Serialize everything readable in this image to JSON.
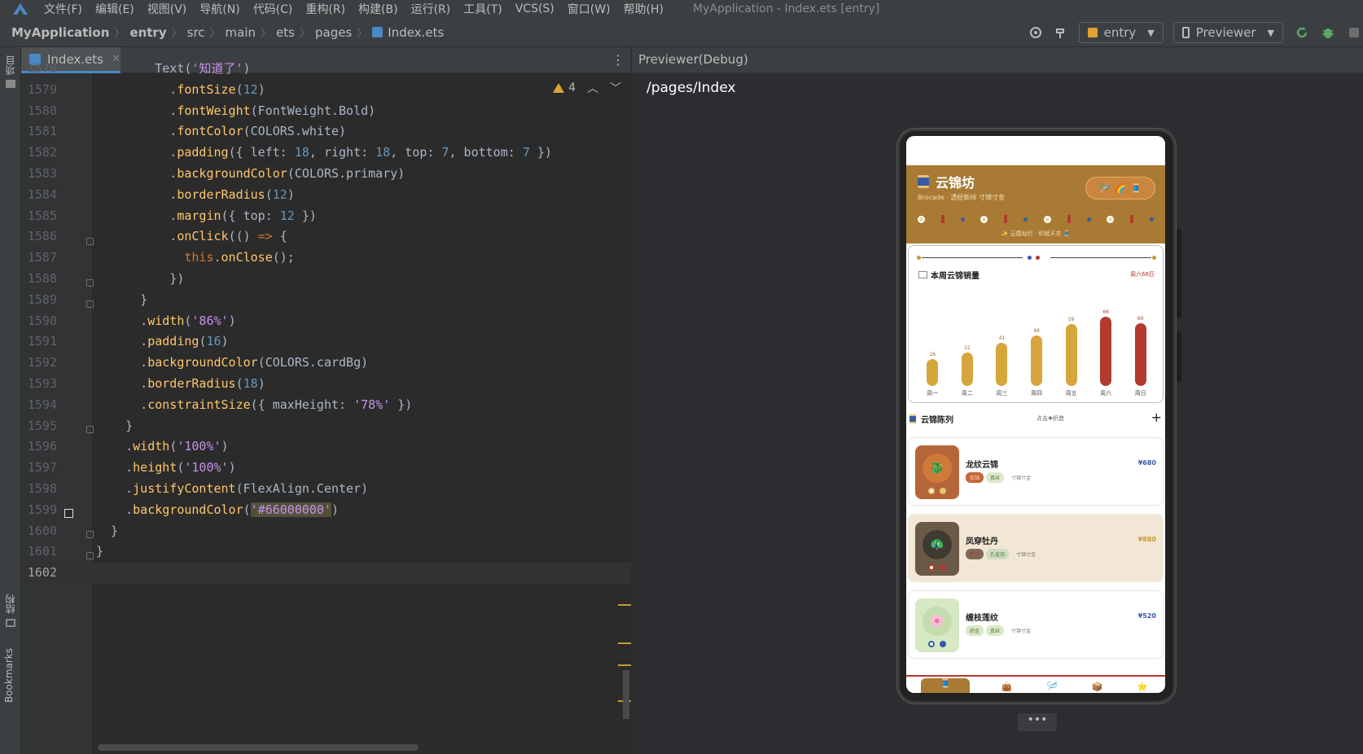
{
  "menu": {
    "items": [
      "文件(F)",
      "编辑(E)",
      "视图(V)",
      "导航(N)",
      "代码(C)",
      "重构(R)",
      "构建(B)",
      "运行(R)",
      "工具(T)",
      "VCS(S)",
      "窗口(W)",
      "帮助(H)"
    ],
    "window_title": "MyApplication - Index.ets [entry]"
  },
  "breadcrumb": [
    "MyApplication",
    "entry",
    "src",
    "main",
    "ets",
    "pages",
    "Index.ets"
  ],
  "toolbar": {
    "module": "entry",
    "device": "Previewer"
  },
  "left_tool": {
    "project": "项目",
    "structure": "结构",
    "bookmarks": "Bookmarks"
  },
  "editor": {
    "tab": "Index.ets",
    "warnings": "4",
    "lines": [
      {
        "n": "1578",
        "c": "        Text('知道了')"
      },
      {
        "n": "1579",
        "c": "          .fontSize(12)"
      },
      {
        "n": "1580",
        "c": "          .fontWeight(FontWeight.Bold)"
      },
      {
        "n": "1581",
        "c": "          .fontColor(COLORS.white)"
      },
      {
        "n": "1582",
        "c": "          .padding({ left: 18, right: 18, top: 7, bottom: 7 })"
      },
      {
        "n": "1583",
        "c": "          .backgroundColor(COLORS.primary)"
      },
      {
        "n": "1584",
        "c": "          .borderRadius(12)"
      },
      {
        "n": "1585",
        "c": "          .margin({ top: 12 })"
      },
      {
        "n": "1586",
        "c": "          .onClick(() => {"
      },
      {
        "n": "1587",
        "c": "            this.onClose();"
      },
      {
        "n": "1588",
        "c": "          })"
      },
      {
        "n": "1589",
        "c": "      }"
      },
      {
        "n": "1590",
        "c": "      .width('86%')"
      },
      {
        "n": "1591",
        "c": "      .padding(16)"
      },
      {
        "n": "1592",
        "c": "      .backgroundColor(COLORS.cardBg)"
      },
      {
        "n": "1593",
        "c": "      .borderRadius(18)"
      },
      {
        "n": "1594",
        "c": "      .constraintSize({ maxHeight: '78%' })"
      },
      {
        "n": "1595",
        "c": "    }"
      },
      {
        "n": "1596",
        "c": "    .width('100%')"
      },
      {
        "n": "1597",
        "c": "    .height('100%')"
      },
      {
        "n": "1598",
        "c": "    .justifyContent(FlexAlign.Center)"
      },
      {
        "n": "1599",
        "c": "    .backgroundColor('#66000000')"
      },
      {
        "n": "1600",
        "c": "  }"
      },
      {
        "n": "1601",
        "c": "}"
      },
      {
        "n": "1602",
        "c": ""
      }
    ]
  },
  "previewer": {
    "header": "Previewer(Debug)",
    "path": "/pages/Index",
    "more": "•••"
  },
  "phone": {
    "app_title": "云锦坊",
    "app_sub": "Brocade · 透经断纬 寸锦寸金",
    "pill_icons": [
      "🪡",
      "🌈",
      "🧵"
    ],
    "slogan": "✨ 云霞灿烂 · 织就天衣 🧵",
    "chart": {
      "title": "本周云锦销量",
      "badge": "周六66匹"
    },
    "section": {
      "title": "云锦陈列",
      "hint": "点击✚织造",
      "plus": "+"
    },
    "cards": [
      {
        "name": "龙纹云锦",
        "price": "¥680",
        "tag1": "库锦",
        "tag2": "真丝",
        "sub": "寸锦寸金",
        "emoji": "🐉"
      },
      {
        "name": "凤穿牡丹",
        "price": "¥880",
        "tag1": "库锦",
        "tag2": "孔雀羽",
        "sub": "寸锦寸金",
        "emoji": "🦚"
      },
      {
        "name": "缠枝莲纹",
        "price": "¥520",
        "tag1": "织金",
        "tag2": "真丝",
        "sub": "寸锦寸金",
        "emoji": "🌸"
      }
    ],
    "tabs": [
      "🧵",
      "👜",
      "🪡",
      "📦",
      "⭐"
    ]
  },
  "chart_data": {
    "type": "bar",
    "title": "本周云锦销量",
    "categories": [
      "周一",
      "周二",
      "周三",
      "周四",
      "周五",
      "周六",
      "周日"
    ],
    "values": [
      26,
      32,
      41,
      48,
      59,
      66,
      60
    ],
    "ylim": [
      0,
      70
    ]
  }
}
